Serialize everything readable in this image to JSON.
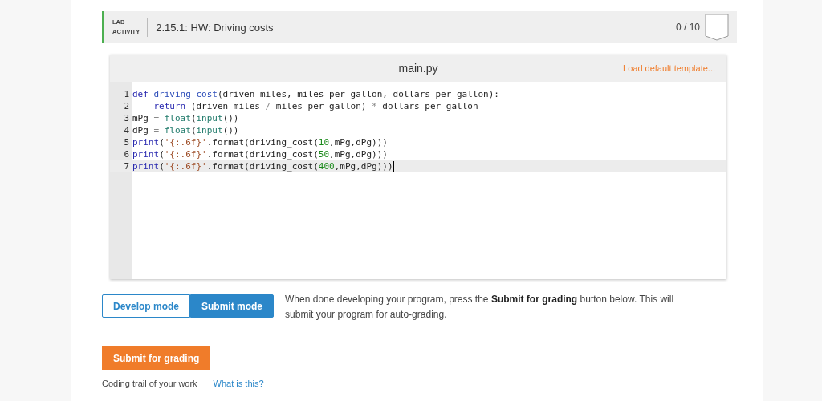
{
  "header": {
    "label_lines": [
      "LAB",
      "ACTIVITY"
    ],
    "title": "2.15.1: HW: Driving costs",
    "score": "0 / 10"
  },
  "editor": {
    "filename": "main.py",
    "template_link": "Load default template...",
    "lines": [
      {
        "number": "1",
        "selected": false,
        "tokens": [
          {
            "kind": "kw",
            "text": "def"
          },
          {
            "kind": "def",
            "text": " driving_cost"
          },
          {
            "kind": "plain",
            "text": "(driven_miles, miles_per_gallon, dollars_per_gallon):"
          }
        ]
      },
      {
        "number": "2",
        "selected": false,
        "tokens": [
          {
            "kind": "kw",
            "text": "    return"
          },
          {
            "kind": "plain",
            "text": " (driven_miles "
          },
          {
            "kind": "op",
            "text": "/"
          },
          {
            "kind": "plain",
            "text": " miles_per_gallon) "
          },
          {
            "kind": "op",
            "text": "*"
          },
          {
            "kind": "plain",
            "text": " dollars_per_gallon"
          }
        ]
      },
      {
        "number": "3",
        "selected": false,
        "tokens": [
          {
            "kind": "plain",
            "text": "mPg"
          },
          {
            "kind": "op",
            "text": " = "
          },
          {
            "kind": "builtin",
            "text": "float"
          },
          {
            "kind": "plain",
            "text": "("
          },
          {
            "kind": "builtin",
            "text": "input"
          },
          {
            "kind": "plain",
            "text": "())"
          }
        ]
      },
      {
        "number": "4",
        "selected": false,
        "tokens": [
          {
            "kind": "plain",
            "text": "dPg"
          },
          {
            "kind": "op",
            "text": " = "
          },
          {
            "kind": "builtin",
            "text": "float"
          },
          {
            "kind": "plain",
            "text": "("
          },
          {
            "kind": "builtin",
            "text": "input"
          },
          {
            "kind": "plain",
            "text": "())"
          }
        ]
      },
      {
        "number": "5",
        "selected": false,
        "tokens": [
          {
            "kind": "kw",
            "text": "print"
          },
          {
            "kind": "plain",
            "text": "("
          },
          {
            "kind": "str",
            "text": "'{:.6f}'"
          },
          {
            "kind": "plain",
            "text": ".format(driving_cost("
          },
          {
            "kind": "num",
            "text": "10"
          },
          {
            "kind": "plain",
            "text": ",mPg,dPg)))"
          }
        ]
      },
      {
        "number": "6",
        "selected": false,
        "tokens": [
          {
            "kind": "kw",
            "text": "print"
          },
          {
            "kind": "plain",
            "text": "("
          },
          {
            "kind": "str",
            "text": "'{:.6f}'"
          },
          {
            "kind": "plain",
            "text": ".format(driving_cost("
          },
          {
            "kind": "num",
            "text": "50"
          },
          {
            "kind": "plain",
            "text": ",mPg,dPg)))"
          }
        ]
      },
      {
        "number": "7",
        "selected": true,
        "tokens": [
          {
            "kind": "kw",
            "text": "print"
          },
          {
            "kind": "plain",
            "text": "("
          },
          {
            "kind": "str",
            "text": "'{:.6f}'"
          },
          {
            "kind": "plain",
            "text": ".format(driving_cost("
          },
          {
            "kind": "num",
            "text": "400"
          },
          {
            "kind": "plain",
            "text": ",mPg,dPg)))"
          }
        ]
      }
    ]
  },
  "modes": [
    {
      "label": "Develop mode",
      "selected": false
    },
    {
      "label": "Submit mode",
      "selected": true
    }
  ],
  "instructions": "When done developing your program, press the **Submit for grading** button below. This will submit your program for auto-grading.",
  "submit_button": "Submit for grading",
  "trail": {
    "label": "Coding trail of your work",
    "link": "What is this?"
  }
}
